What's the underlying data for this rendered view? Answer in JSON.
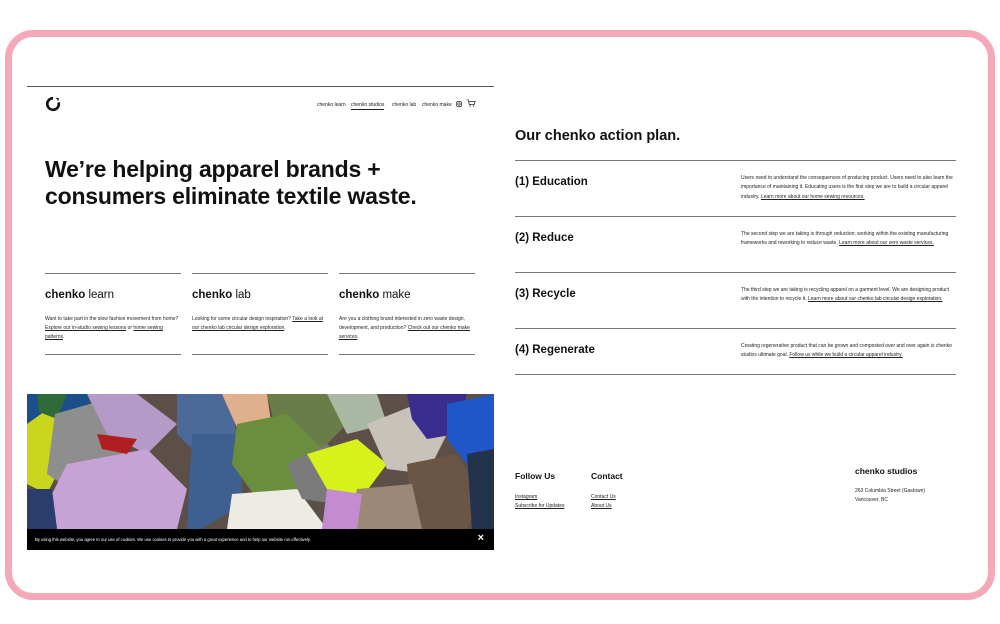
{
  "site": {
    "logo": "circle-logo",
    "nav": [
      {
        "label": "chenko learn"
      },
      {
        "label": "chenko studios"
      },
      {
        "label": "chenko lab"
      },
      {
        "label": "chenko make"
      }
    ],
    "icons": [
      "instagram-icon",
      "cart-icon"
    ]
  },
  "hero": {
    "line1": "We’re helping apparel brands +",
    "line2": "consumers eliminate textile waste."
  },
  "columns": [
    {
      "brand": "chenko",
      "suffix": " learn",
      "text_pre": "Want to take part in the slow fashion movement from home? ",
      "link1": "Explore our in-studio sewing lessons",
      "text_mid": " or ",
      "link2": "home sewing patterns",
      "text_post": "."
    },
    {
      "brand": "chenko",
      "suffix": " lab",
      "text_pre": "Looking for some circular design inspiration? ",
      "link1": "Take a look at our chenko lab circular design exploration",
      "text_post": "."
    },
    {
      "brand": "chenko",
      "suffix": " make",
      "text_pre": "Are you a clothing brand interested in zero waste design, development, and production? ",
      "link1": "Check out our chenko make services",
      "text_post": "."
    }
  ],
  "cookie": {
    "text": "By using this website, you agree to our use of cookies. We use cookies to provide you with a great experience and to help our website run effectively.",
    "close": "×"
  },
  "plan": {
    "title": "Our chenko action plan.",
    "steps": [
      {
        "heading": "(1) Education",
        "text": "Users need to understand the consequences of producing product. Users need to also learn the importance of maintaining it. Educating users is the first step we are to build a circular apparel industry. ",
        "link": "Learn more about our home sewing resources."
      },
      {
        "heading": "(2) Reduce",
        "text": "The second step we are taking is through reduction; working within the existing manufacturing frameworks and reworking to reduce waste. ",
        "link": "Learn more about our zero waste services."
      },
      {
        "heading": "(3) Recycle",
        "text": "The third step we are taking is recycling apparel on a garment level. We are designing product with the intention to recycle it. ",
        "link": "Learn more about our chenko lab circular design exploration."
      },
      {
        "heading": "(4) Regenerate",
        "text": "Creating regenerative product that can be grown and composted over and over again is chenko studios ultimate goal. ",
        "link": "Follow us while we build a circular apparel industry."
      }
    ]
  },
  "footer": {
    "follow": {
      "title": "Follow Us",
      "links": [
        "Instagram",
        "Subscribe for Updates"
      ]
    },
    "contact": {
      "title": "Contact",
      "links": [
        "Contact Us",
        "About Us"
      ]
    },
    "studio": {
      "title": "chenko studios",
      "address1": "263 Columbia Street (Gastown)",
      "address2": "Vancouver, BC"
    }
  }
}
